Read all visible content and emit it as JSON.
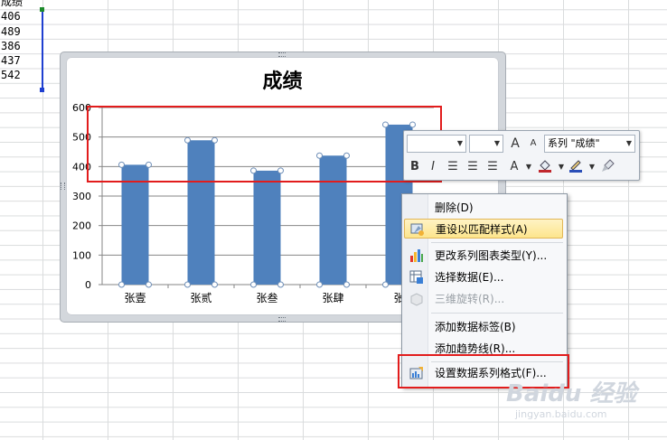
{
  "sheet": {
    "header": "成绩",
    "values": [
      "406",
      "489",
      "386",
      "437",
      "542"
    ]
  },
  "chart_data": {
    "type": "bar",
    "title": "成绩",
    "categories": [
      "张壹",
      "张贰",
      "张叁",
      "张肆",
      "张伍"
    ],
    "visible_category_labels": [
      "张壹",
      "张贰",
      "张叁",
      "张肆",
      "张"
    ],
    "series": [
      {
        "name": "成绩",
        "values": [
          406,
          489,
          386,
          437,
          542
        ]
      }
    ],
    "ylim": [
      0,
      600
    ],
    "yticks": [
      "0",
      "100",
      "200",
      "300",
      "400",
      "500",
      "600"
    ],
    "grid": true,
    "bar_color": "#4f81bd"
  },
  "mini_toolbar": {
    "font_box": "",
    "size_box": "",
    "grow_icon": "A",
    "shrink_icon": "A",
    "series_selector": "系列 \"成绩\"",
    "bold": "B",
    "italic": "I"
  },
  "context_menu": {
    "items": [
      {
        "label": "删除(D)",
        "icon": "",
        "disabled": false
      },
      {
        "label": "重设以匹配样式(A)",
        "icon": "reset-style-icon",
        "disabled": false,
        "highlighted": true
      },
      {
        "label": "更改系列图表类型(Y)...",
        "icon": "chart-type-icon",
        "disabled": false
      },
      {
        "label": "选择数据(E)...",
        "icon": "select-data-icon",
        "disabled": false
      },
      {
        "label": "三维旋转(R)...",
        "icon": "3d-rotate-icon",
        "disabled": true
      },
      {
        "label": "添加数据标签(B)",
        "icon": "",
        "disabled": false
      },
      {
        "label": "添加趋势线(R)...",
        "icon": "",
        "disabled": false
      },
      {
        "label": "设置数据系列格式(F)...",
        "icon": "format-series-icon",
        "disabled": false
      }
    ]
  },
  "watermark": {
    "logo": "Baidu 经验",
    "url": "jingyan.baidu.com"
  },
  "colors": {
    "highlight_box": "#e21c1c",
    "selection": "#1f3fd0"
  }
}
